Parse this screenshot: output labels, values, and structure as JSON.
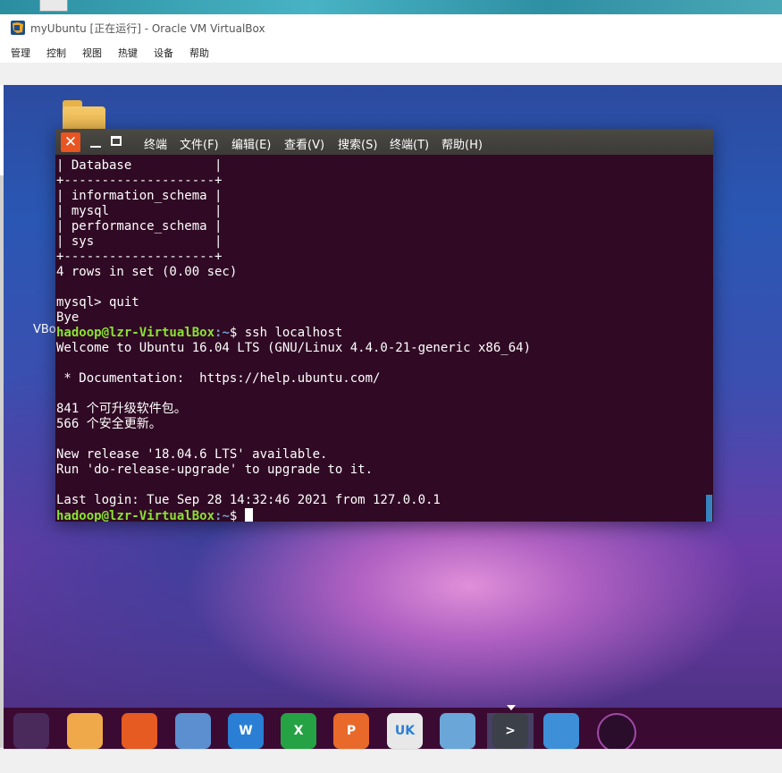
{
  "window": {
    "title": "myUbuntu [正在运行] - Oracle VM VirtualBox"
  },
  "menubar": [
    "管理",
    "控制",
    "视图",
    "热键",
    "设备",
    "帮助"
  ],
  "desktop": {
    "sliver_label": "VBo"
  },
  "terminal": {
    "close_glyph": "✕",
    "menu": [
      "终端",
      "文件(F)",
      "编辑(E)",
      "查看(V)",
      "搜索(S)",
      "终端(T)",
      "帮助(H)"
    ],
    "lines": [
      "| Database           |",
      "+--------------------+",
      "| information_schema |",
      "| mysql              |",
      "| performance_schema |",
      "| sys                |",
      "+--------------------+",
      "4 rows in set (0.00 sec)",
      "",
      "mysql> quit",
      "Bye"
    ],
    "prompt_user": "hadoop@lzr-VirtualBox",
    "prompt_path": ":~",
    "prompt_sep": "$ ",
    "cmd1": "ssh localhost",
    "lines2": [
      "Welcome to Ubuntu 16.04 LTS (GNU/Linux 4.4.0-21-generic x86_64)",
      "",
      " * Documentation:  https://help.ubuntu.com/",
      "",
      "841 个可升级软件包。",
      "566 个安全更新。",
      "",
      "New release '18.04.6 LTS' available.",
      "Run 'do-release-upgrade' to upgrade to it.",
      "",
      "Last login: Tue Sep 28 14:32:46 2021 from 127.0.0.1"
    ]
  },
  "dock": [
    {
      "icon": "ubuntu-logo-icon",
      "color": "#4a2a5a",
      "label": ""
    },
    {
      "icon": "files-icon",
      "color": "#f0a94a",
      "label": ""
    },
    {
      "icon": "firefox-icon",
      "color": "#e55b22",
      "label": ""
    },
    {
      "icon": "browser-icon",
      "color": "#5b8fd0",
      "label": ""
    },
    {
      "icon": "writer-icon",
      "color": "#2a7fd4",
      "label": "W"
    },
    {
      "icon": "spreadsheet-icon",
      "color": "#25a244",
      "label": "X"
    },
    {
      "icon": "presentation-icon",
      "color": "#e8692a",
      "label": "P"
    },
    {
      "icon": "software-center-icon",
      "color": "#e8e8e8",
      "label": "UK"
    },
    {
      "icon": "remote-desktop-icon",
      "color": "#6aa6d8",
      "label": ""
    },
    {
      "icon": "terminal-icon",
      "color": "#3c4048",
      "label": ">"
    },
    {
      "icon": "workspaces-icon",
      "color": "#3d8fd8",
      "label": ""
    },
    {
      "icon": "disc-icon",
      "color": "#2a0d2a",
      "label": ""
    }
  ]
}
